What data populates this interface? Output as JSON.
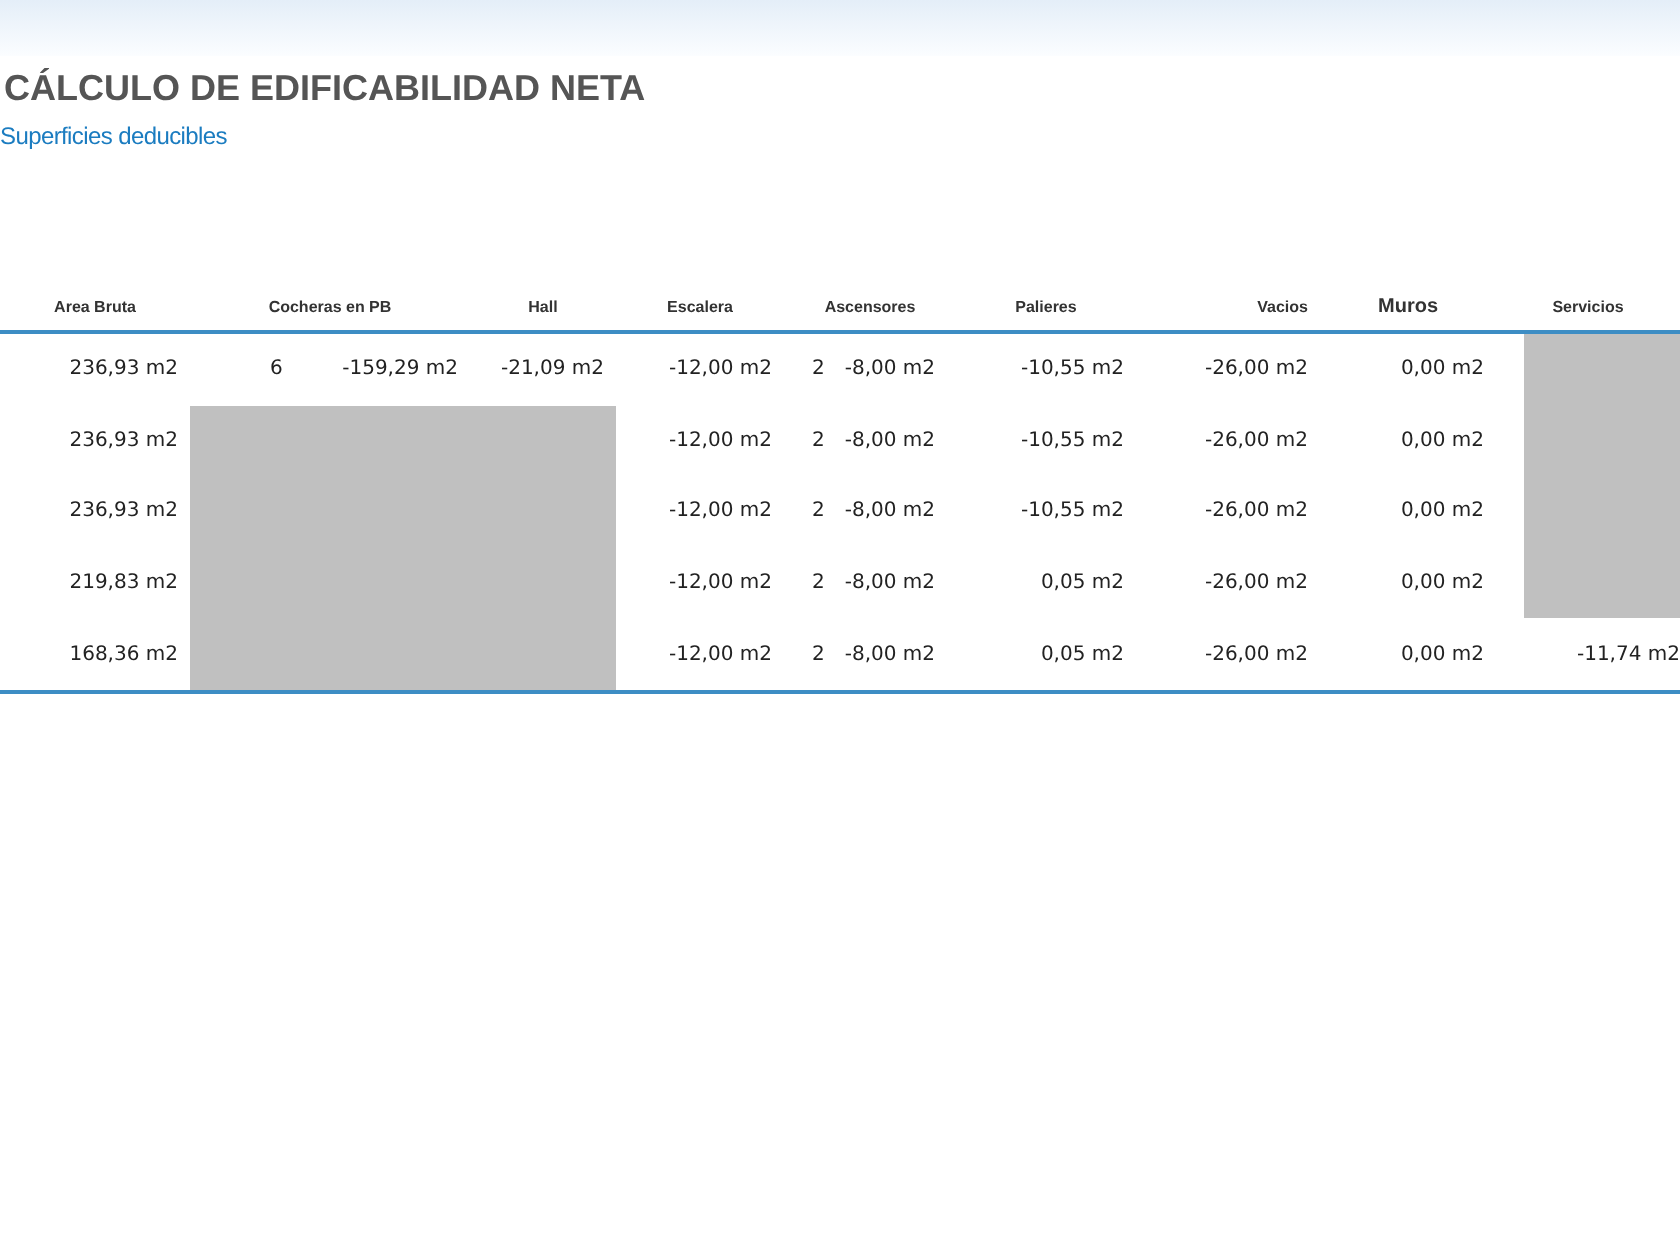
{
  "title": "CÁLCULO DE EDIFICABILIDAD NETA",
  "subtitle": "Superficies deducibles",
  "table": {
    "columns": [
      "Area Bruta",
      "Cocheras en PB",
      "Hall",
      "Escalera",
      "Ascensores",
      "Palieres",
      "Vacios",
      "Muros",
      "Servicios"
    ],
    "rows": [
      {
        "area_bruta": "236,93 m2",
        "cocheras_hidden": false,
        "cocheras_count": "6",
        "cocheras_area": "-159,29 m2",
        "hall": "-21,09 m2",
        "escalera": "-12,00 m2",
        "ascensores_count": "2",
        "ascensores_area": "-8,00 m2",
        "palieres": "-10,55 m2",
        "vacios": "-26,00 m2",
        "muros": "0,00 m2",
        "servicios_hidden": true
      },
      {
        "area_bruta": "236,93 m2",
        "cocheras_hidden": true,
        "escalera": "-12,00 m2",
        "ascensores_count": "2",
        "ascensores_area": "-8,00 m2",
        "palieres": "-10,55 m2",
        "vacios": "-26,00 m2",
        "muros": "0,00 m2",
        "servicios_hidden": true
      },
      {
        "area_bruta": "236,93 m2",
        "cocheras_hidden": true,
        "escalera": "-12,00 m2",
        "ascensores_count": "2",
        "ascensores_area": "-8,00 m2",
        "palieres": "-10,55 m2",
        "vacios": "-26,00 m2",
        "muros": "0,00 m2",
        "servicios_hidden": true
      },
      {
        "area_bruta": "219,83 m2",
        "cocheras_hidden": true,
        "escalera": "-12,00 m2",
        "ascensores_count": "2",
        "ascensores_area": "-8,00 m2",
        "palieres": "0,05 m2",
        "vacios": "-26,00 m2",
        "muros": "0,00 m2",
        "servicios_hidden": true
      },
      {
        "area_bruta": "168,36 m2",
        "cocheras_hidden": true,
        "escalera": "-12,00 m2",
        "ascensores_count": "2",
        "ascensores_area": "-8,00 m2",
        "palieres": "0,05 m2",
        "vacios": "-26,00 m2",
        "muros": "0,00 m2",
        "servicios_hidden": false,
        "servicios": "-11,74 m2"
      }
    ]
  }
}
